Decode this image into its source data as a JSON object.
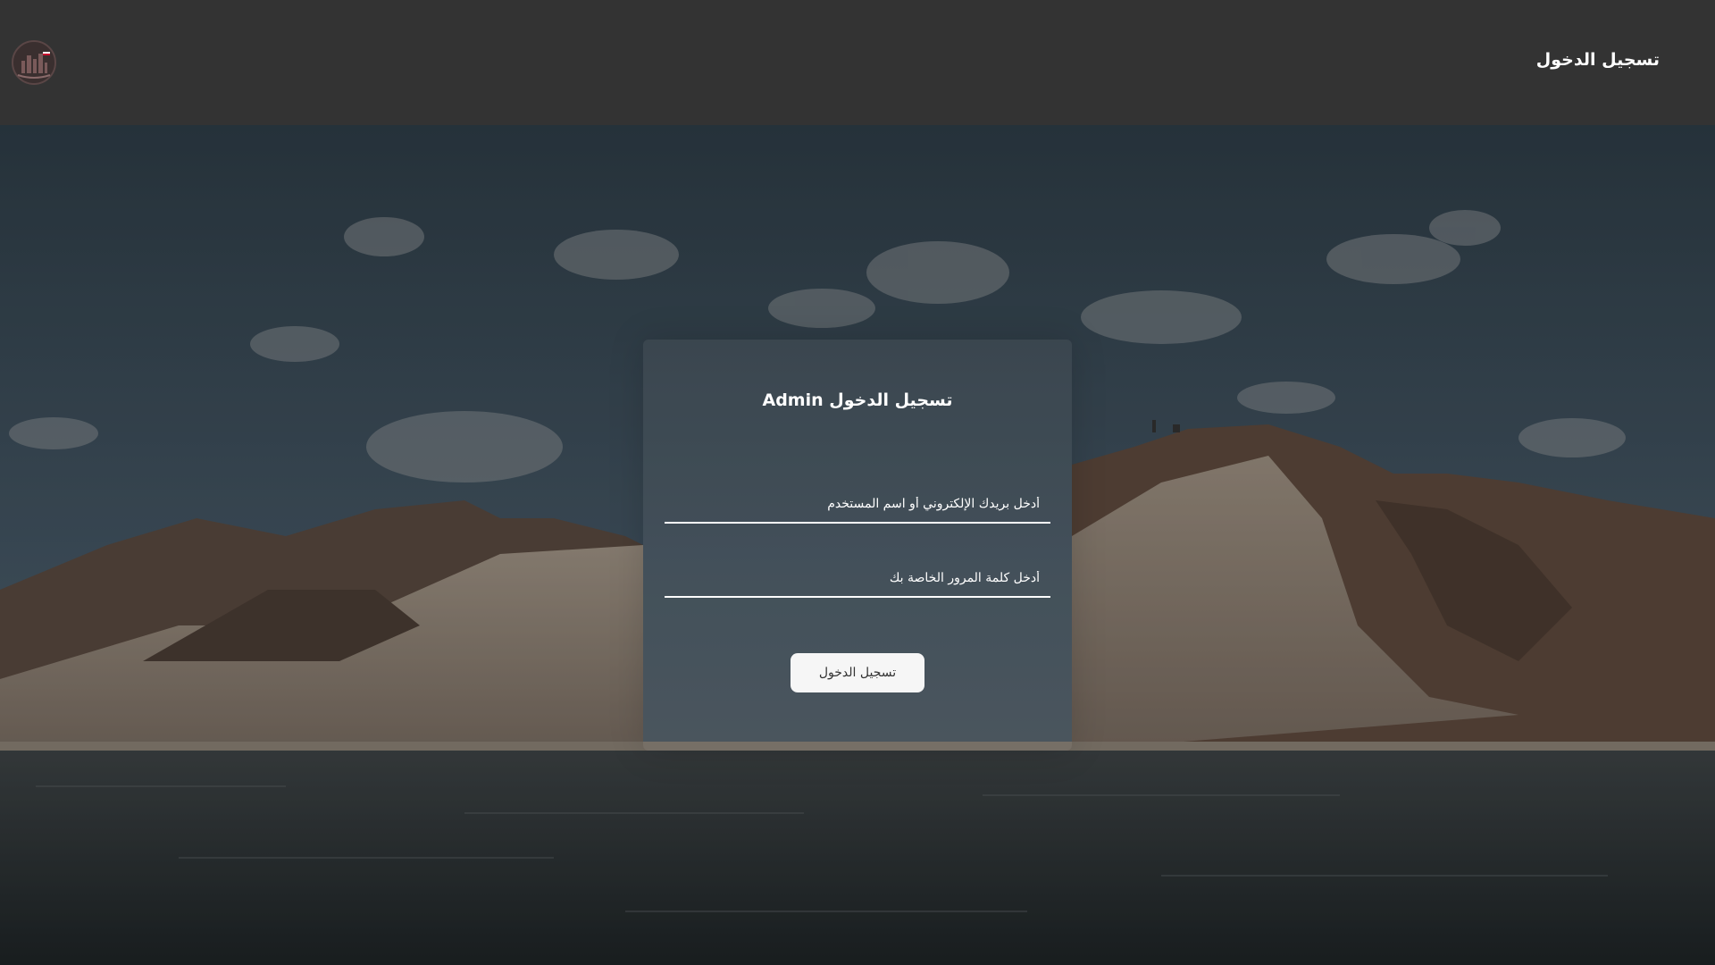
{
  "header": {
    "nav_title": "تسجيل الدخول",
    "logo_icon": "city-emblem-icon"
  },
  "login": {
    "title": "تسجيل الدخول Admin",
    "email_placeholder": "أدخل بريدك الإلكتروني أو اسم المستخدم",
    "email_value": "",
    "password_placeholder": "أدخل كلمة المرور الخاصة بك",
    "password_value": "",
    "submit_label": "تسجيل الدخول"
  },
  "colors": {
    "topbar": "#333333",
    "button_bg": "#f6f6f6",
    "text": "#ffffff"
  }
}
